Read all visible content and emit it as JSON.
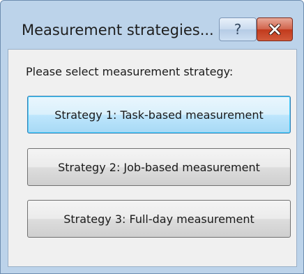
{
  "window": {
    "title": "Measurement strategies...",
    "help_label": "?",
    "close_icon": "close-icon"
  },
  "dialog": {
    "prompt": "Please select measurement strategy:",
    "buttons": [
      {
        "label": "Strategy 1: Task-based measurement",
        "focused": true
      },
      {
        "label": "Strategy 2: Job-based measurement",
        "focused": false
      },
      {
        "label": "Strategy 3: Full-day measurement",
        "focused": false
      }
    ]
  },
  "colors": {
    "frame": "#bcd3ea",
    "client_bg": "#f0f0f0",
    "close_button": "#c1391c",
    "focus_border": "#3c7fb1"
  }
}
